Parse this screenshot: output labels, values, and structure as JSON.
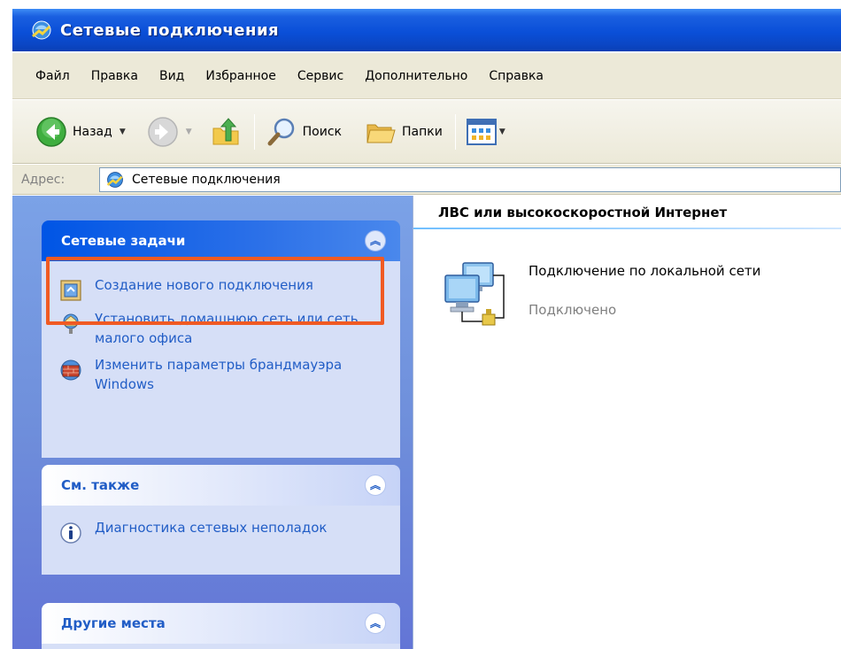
{
  "window": {
    "title": "Сетевые подключения",
    "title_icon": "network-connections-icon"
  },
  "menu": [
    "Файл",
    "Правка",
    "Вид",
    "Избранное",
    "Сервис",
    "Дополнительно",
    "Справка"
  ],
  "toolbar": {
    "back_label": "Назад",
    "search_label": "Поиск",
    "folders_label": "Папки"
  },
  "address": {
    "label": "Адрес:",
    "value": "Сетевые подключения"
  },
  "taskpane": {
    "network_tasks": {
      "title": "Сетевые задачи",
      "items": [
        {
          "label": "Создание нового подключения",
          "icon": "new-connection-wizard-icon"
        },
        {
          "label": "Установить домашнюю сеть или сеть малого офиса",
          "icon": "home-network-icon"
        },
        {
          "label": "Изменить параметры брандмауэра Windows",
          "icon": "firewall-icon"
        }
      ]
    },
    "see_also": {
      "title": "См. также",
      "items": [
        {
          "label": "Диагностика сетевых неполадок",
          "icon": "info-icon"
        }
      ]
    },
    "other_places": {
      "title": "Другие места"
    }
  },
  "content": {
    "section_title": "ЛВС или высокоскоростной Интернет",
    "connection": {
      "name": "Подключение по локальной сети",
      "status": "Подключено"
    }
  },
  "colors": {
    "titlebar": "#0a4fd8",
    "taskpane_bg": "#6f8fdb",
    "task_link": "#215dc6",
    "highlight": "#f05a23"
  }
}
